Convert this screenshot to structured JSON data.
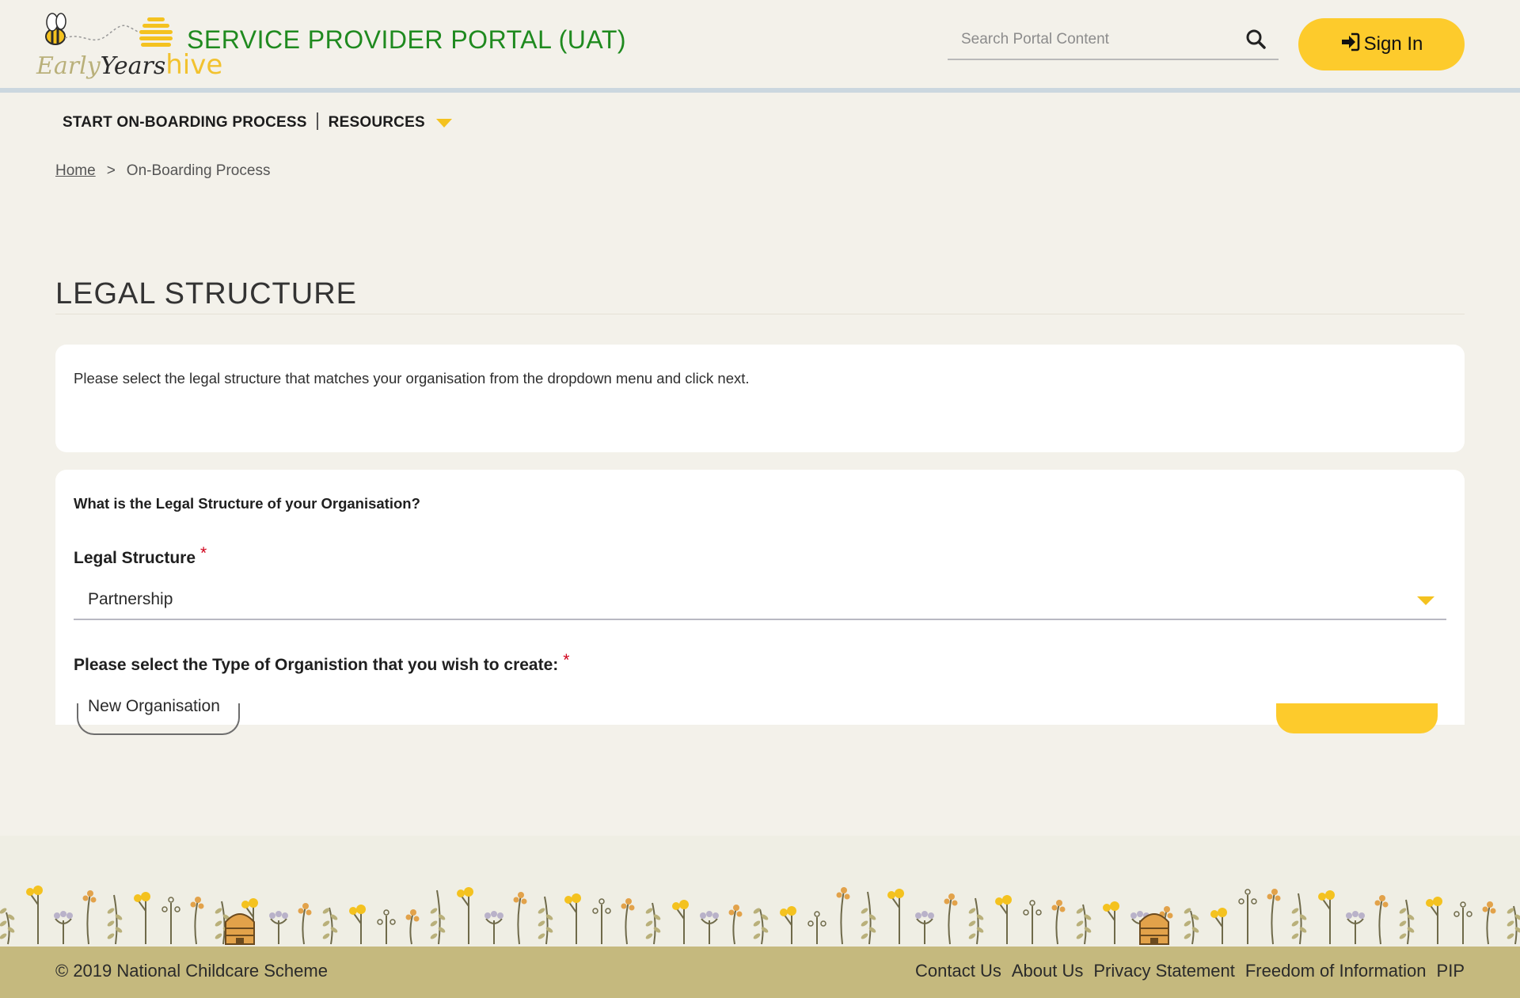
{
  "header": {
    "logo": {
      "word1": "Early",
      "word2": "Years",
      "word3": "hive"
    },
    "portal_title": "SERVICE PROVIDER PORTAL (UAT)",
    "search": {
      "placeholder": "Search Portal Content",
      "icon": "search-icon"
    },
    "signin": {
      "label": "Sign In",
      "icon": "sign-in-icon"
    }
  },
  "nav": {
    "items": [
      {
        "label": "START ON-BOARDING PROCESS"
      },
      {
        "label": "RESOURCES",
        "icon": "caret-down-icon"
      }
    ]
  },
  "breadcrumb": {
    "home": "Home",
    "separator": ">",
    "current": "On-Boarding Process"
  },
  "main": {
    "title": "LEGAL STRUCTURE",
    "intro": "Please select the legal structure that matches your organisation from the dropdown menu and click next.",
    "section_question": "What is the Legal Structure of your Organisation?",
    "fields": [
      {
        "label": "Legal Structure",
        "required_mark": "*",
        "value": "Partnership"
      },
      {
        "label": "Please select the Type of Organistion that you wish to create:",
        "required_mark": "*",
        "value": "New Organisation"
      }
    ]
  },
  "footer": {
    "copyright": "© 2019 National Childcare Scheme",
    "links": [
      "Contact Us",
      "About Us",
      "Privacy Statement",
      "Freedom of Information",
      "PIP"
    ]
  },
  "colors": {
    "background": "#f3f1ea",
    "accent_yellow": "#fdcb2c",
    "title_green": "#1f8a1f",
    "footer_bar": "#c5b97e",
    "required_red": "#d0021b"
  }
}
